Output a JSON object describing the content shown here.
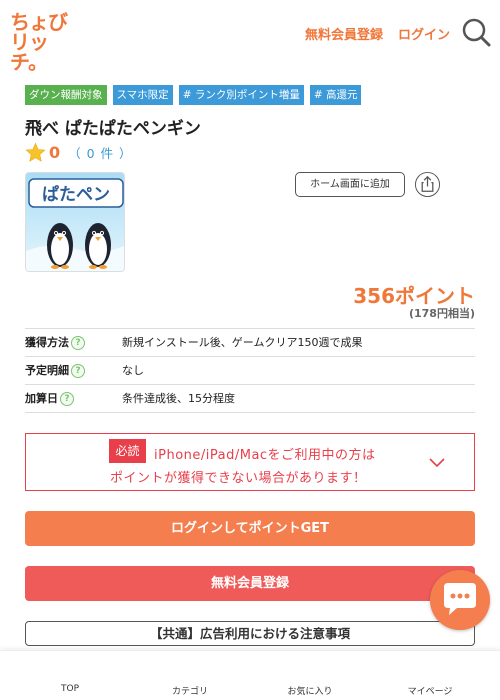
{
  "header": {
    "logo_line1": "ちょび",
    "logo_line2": "リッチ。",
    "register_label": "無料会員登録",
    "login_label": "ログイン",
    "search_icon": "search-icon"
  },
  "tags": [
    {
      "label": "ダウン報酬対象",
      "color": "#58b04f"
    },
    {
      "label": "スマホ限定",
      "color": "#3c9ad8"
    },
    {
      "label": "# ランク別ポイント増量",
      "color": "#3c9ad8"
    },
    {
      "label": "# 高還元",
      "color": "#3c9ad8"
    }
  ],
  "offer": {
    "title": "飛べ ぱたぱたペンギン",
    "rating_value": "0",
    "rating_count": "（ 0 件 ）",
    "icon_text": "ぱたペン",
    "home_button_label": "ホーム画面に追加",
    "points": "356ポイント",
    "yen": "(178円相当)"
  },
  "info": [
    {
      "label": "獲得方法",
      "value": "新規インストール後、ゲームクリア150週で成果"
    },
    {
      "label": "予定明細",
      "value": "なし"
    },
    {
      "label": "加算日",
      "value": "条件達成後、15分程度"
    }
  ],
  "help_glyph": "?",
  "notice": {
    "badge": "必読",
    "line1": "iPhone/iPad/Macをご利用中の方は",
    "line2": "ポイントが獲得できない場合があります！"
  },
  "buttons": {
    "login": "ログインしてポイントGET",
    "register": "無料会員登録",
    "ad_notice": "【共通】広告利用における注意事項"
  },
  "bottom_nav": [
    {
      "label": "TOP",
      "icon": "home-icon"
    },
    {
      "label": "カテゴリ",
      "icon": "category-icon"
    },
    {
      "label": "お気に入り",
      "icon": "heart-icon"
    },
    {
      "label": "マイページ",
      "icon": "user-icon"
    }
  ],
  "colors": {
    "brand": "#f0773a",
    "login_button": "#f47e4d",
    "register_button": "#ef5b58",
    "alert": "#e83f4a",
    "tag_green": "#58b04f",
    "tag_blue": "#3c9ad8"
  }
}
